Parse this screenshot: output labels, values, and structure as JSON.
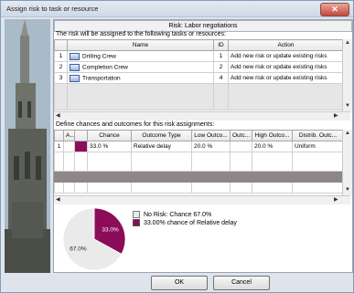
{
  "window": {
    "title": "Assign risk to task or resource",
    "close": "✕"
  },
  "risk_header": "Risk: Labor negotiations",
  "assign_label": "The risk will be assigned to the following tasks or resources:",
  "tasks": {
    "columns": [
      "Name",
      "ID",
      "Action"
    ],
    "rows": [
      {
        "num": "1",
        "name": "Drilling Crew",
        "id": "1",
        "action": "Add new risk or update existing risks"
      },
      {
        "num": "2",
        "name": "Completion Crew",
        "id": "2",
        "action": "Add new risk or update existing risks"
      },
      {
        "num": "3",
        "name": "Transportation",
        "id": "4",
        "action": "Add new risk or update existing risks"
      }
    ]
  },
  "chances_label": "Define chances and outcomes for this risk assignments:",
  "outcomes": {
    "columns": [
      "A...",
      "Chance",
      "Outcome Type",
      "Low Outco...",
      "Outc...",
      "High Outco...",
      "Distrib. Outc..."
    ],
    "rows": [
      {
        "num": "1",
        "chance": "33.0 %",
        "type": "Relative delay",
        "low": "20.0 %",
        "mid": "",
        "high": "20.0 %",
        "dist": "Uniform"
      }
    ]
  },
  "pie": {
    "slices": [
      {
        "label": "No Risk: Chance 67.0%",
        "value": 67.0,
        "display": "67.0%",
        "color": "#eaeaea"
      },
      {
        "label": "33.00% chance of Relative delay",
        "value": 33.0,
        "display": "33.0%",
        "color": "#8b0d59"
      }
    ]
  },
  "buttons": {
    "ok": "OK",
    "cancel": "Cancel"
  },
  "colors": {
    "accent": "#8b0d59"
  }
}
